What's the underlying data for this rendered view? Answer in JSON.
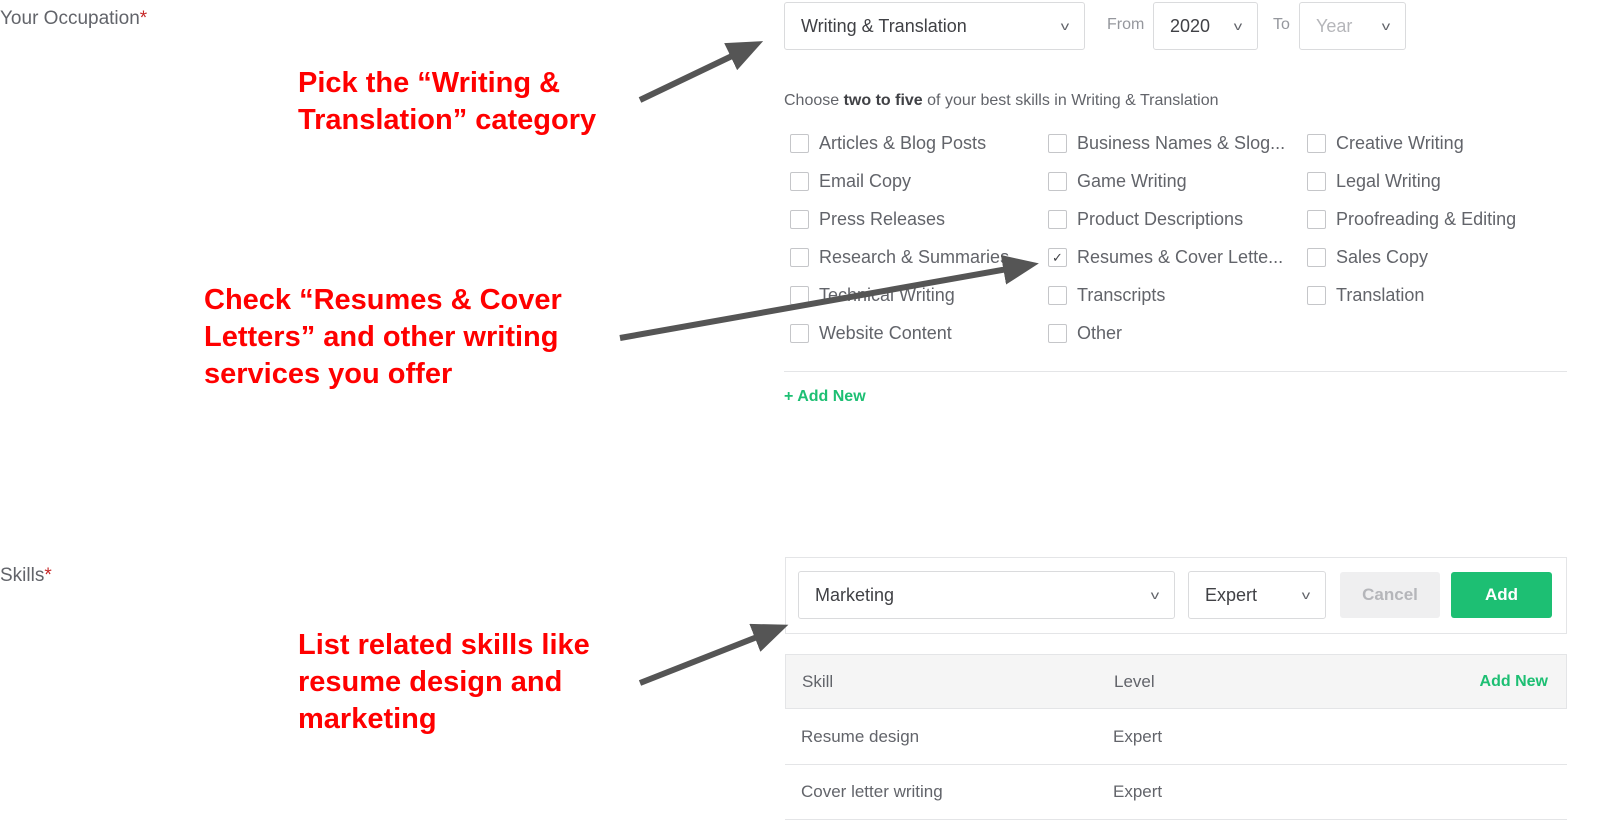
{
  "occupation": {
    "label": "Your Occupation",
    "required": "*",
    "category": "Writing & Translation",
    "from_label": "From",
    "from_value": "2020",
    "to_label": "To",
    "to_placeholder": "Year",
    "instruction_pre": "Choose ",
    "instruction_bold": "two to five",
    "instruction_post": " of your best skills in Writing & Translation",
    "skills": [
      {
        "label": "Articles & Blog Posts",
        "checked": false
      },
      {
        "label": "Business Names & Slog...",
        "checked": false
      },
      {
        "label": "Creative Writing",
        "checked": false
      },
      {
        "label": "Email Copy",
        "checked": false
      },
      {
        "label": "Game Writing",
        "checked": false
      },
      {
        "label": "Legal Writing",
        "checked": false
      },
      {
        "label": "Press Releases",
        "checked": false
      },
      {
        "label": "Product Descriptions",
        "checked": false
      },
      {
        "label": "Proofreading & Editing",
        "checked": false
      },
      {
        "label": "Research & Summaries",
        "checked": false
      },
      {
        "label": "Resumes & Cover Lette...",
        "checked": true
      },
      {
        "label": "Sales Copy",
        "checked": false
      },
      {
        "label": "Technical Writing",
        "checked": false
      },
      {
        "label": "Transcripts",
        "checked": false
      },
      {
        "label": "Translation",
        "checked": false
      },
      {
        "label": "Website Content",
        "checked": false
      },
      {
        "label": "Other",
        "checked": false
      }
    ],
    "add_new": "+ Add New"
  },
  "skills": {
    "label": "Skills",
    "required": "*",
    "skill_value": "Marketing",
    "level_value": "Expert",
    "cancel": "Cancel",
    "add": "Add",
    "table": {
      "headers": [
        "Skill",
        "Level"
      ],
      "add_new": "Add New",
      "rows": [
        [
          "Resume design",
          "Expert"
        ],
        [
          "Cover letter writing",
          "Expert"
        ]
      ]
    }
  },
  "annotations": {
    "a1": [
      "Pick the “Writing &",
      "Translation” category"
    ],
    "a2": [
      "Check “Resumes & Cover",
      "Letters” and other writing",
      "services you offer"
    ],
    "a3": [
      "List related skills like",
      "resume design and",
      "marketing"
    ]
  },
  "colors": {
    "accent": "#1dbf73",
    "annotation": "#ff0000",
    "arrow": "#555555"
  }
}
